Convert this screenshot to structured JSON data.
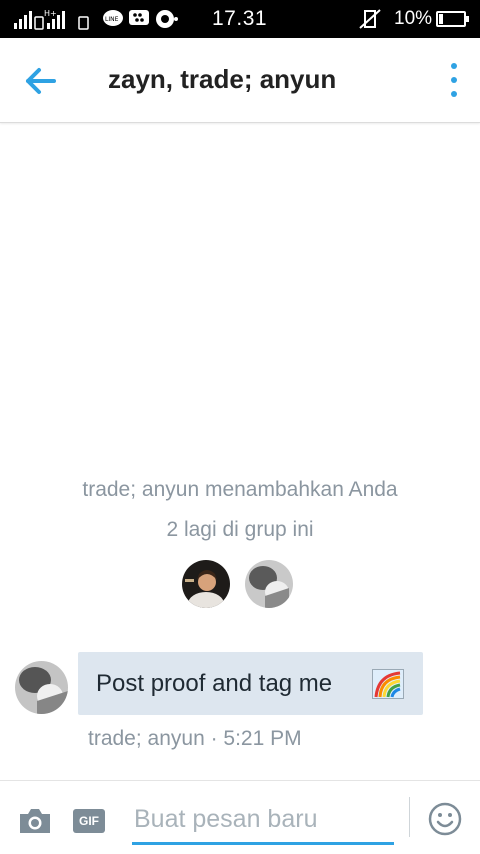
{
  "status_bar": {
    "time": "17.31",
    "battery": "10%",
    "icons": [
      "signal-icon",
      "data-icon",
      "line-app-icon",
      "bbm-icon",
      "camera-app-icon",
      "vibrate-off-icon",
      "battery-icon"
    ]
  },
  "header": {
    "title": "zayn, trade; anyun",
    "accent_color": "#2fa2e3"
  },
  "system": {
    "added_text": "trade; anyun menambahkan Anda",
    "members_text": "2 lagi di grup ini"
  },
  "message": {
    "text": "Post proof and tag me",
    "emoji": "rainbow-icon",
    "meta": "trade; anyun · 5:21 PM"
  },
  "composer": {
    "placeholder": "Buat pesan baru",
    "gif_label": "GIF"
  }
}
